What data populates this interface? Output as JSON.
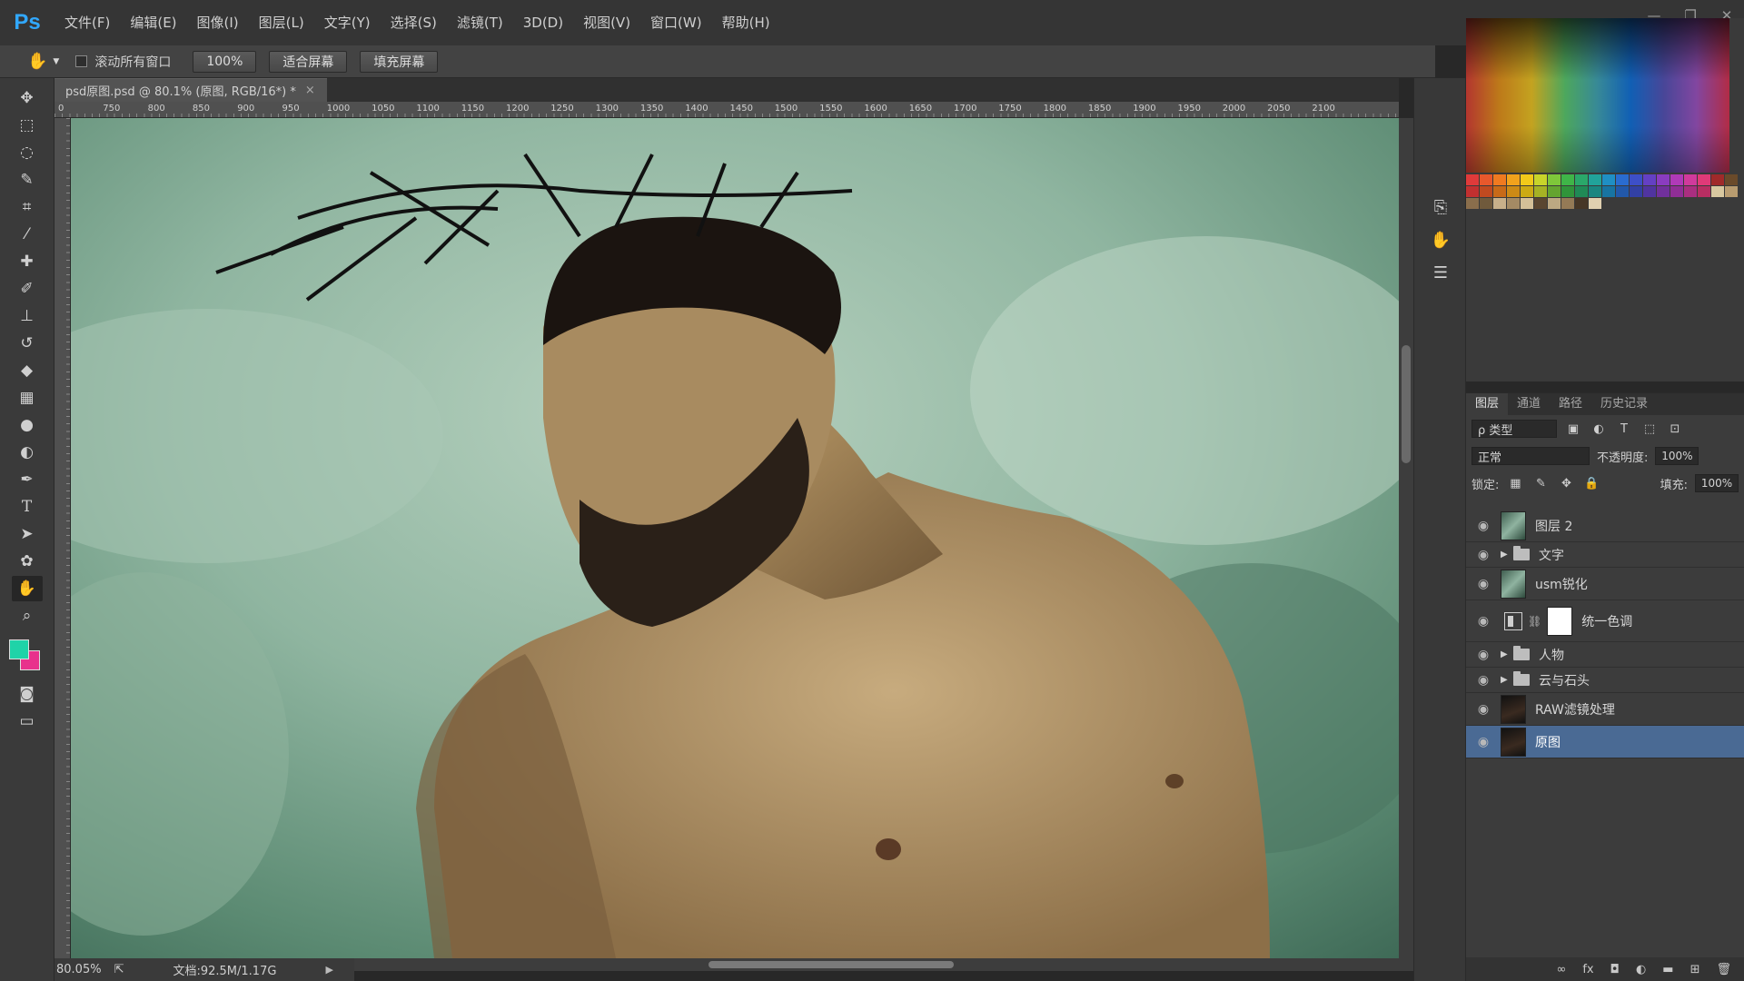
{
  "app": {
    "logo": "Ps"
  },
  "menu": [
    "文件(F)",
    "编辑(E)",
    "图像(I)",
    "图层(L)",
    "文字(Y)",
    "选择(S)",
    "滤镜(T)",
    "3D(D)",
    "视图(V)",
    "窗口(W)",
    "帮助(H)"
  ],
  "window_controls": {
    "minimize": "—",
    "restore": "❐",
    "close": "✕"
  },
  "options_bar": {
    "tool_icon": "hand-icon",
    "scroll_all_label": "滚动所有窗口",
    "zoom_button": "100%",
    "fit_screen_button": "适合屏幕",
    "fill_screen_button": "填充屏幕"
  },
  "document": {
    "tab_title": "psd原图.psd @ 80.1% (原图, RGB/16*) *",
    "tab_close": "×"
  },
  "ruler": {
    "top_labels": [
      "0",
      "750",
      "800",
      "850",
      "900",
      "950",
      "1000",
      "1050",
      "1100",
      "1150",
      "1200",
      "1250",
      "1300",
      "1350",
      "1400",
      "1450",
      "1500",
      "1550",
      "1600",
      "1650",
      "1700",
      "1750",
      "1800",
      "1850",
      "1900",
      "1950",
      "2000",
      "2050",
      "2100"
    ]
  },
  "status": {
    "zoom": "80.05%",
    "doc_size": "文档:92.5M/1.17G",
    "arrow": "▶"
  },
  "tools": [
    "move",
    "marquee",
    "lasso",
    "quick-select",
    "crop",
    "eyedropper",
    "healing",
    "brush",
    "clone-stamp",
    "history-brush",
    "eraser",
    "gradient",
    "blur",
    "dodge",
    "pen",
    "type",
    "path-select",
    "shape",
    "hand",
    "zoom"
  ],
  "colors": {
    "foreground": "#1fd3a8",
    "background": "#e8328c",
    "selected_layer": "#4a6a94",
    "accent": "#31a8ff"
  },
  "layers_panel": {
    "tabs": [
      "图层",
      "通道",
      "路径",
      "历史记录"
    ],
    "filter_kind": "ρ 类型",
    "blend_mode": "正常",
    "opacity_label": "不透明度:",
    "opacity_value": "100%",
    "lock_label": "锁定:",
    "fill_label": "填充:",
    "fill_value": "100%",
    "layers": [
      {
        "name": "图层 2",
        "kind": "pixel",
        "selected": false
      },
      {
        "name": "文字",
        "kind": "group",
        "selected": false
      },
      {
        "name": "usm锐化",
        "kind": "pixel",
        "selected": false
      },
      {
        "name": "统一色调",
        "kind": "adjustment",
        "selected": false
      },
      {
        "name": "人物",
        "kind": "group",
        "selected": false
      },
      {
        "name": "云与石头",
        "kind": "group",
        "selected": false
      },
      {
        "name": "RAW滤镜处理",
        "kind": "pixel",
        "selected": false
      },
      {
        "name": "原图",
        "kind": "pixel",
        "selected": true
      }
    ],
    "footer_icons": [
      "link-icon",
      "fx-icon",
      "mask-icon",
      "adjustment-icon",
      "folder-icon",
      "new-layer-icon",
      "trash-icon"
    ]
  }
}
